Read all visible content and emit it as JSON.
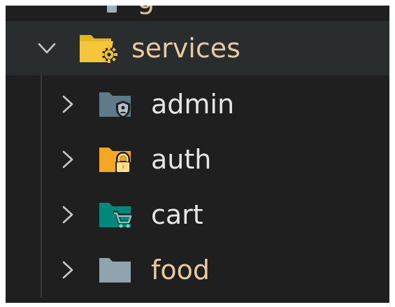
{
  "explorer": {
    "root": {
      "label": "services",
      "icon": "folder-open-gear-icon",
      "expanded": true,
      "color": "#f0c22e"
    },
    "children": [
      {
        "label": "admin",
        "icon": "folder-admin-shield-icon",
        "expanded": false,
        "color": "#607d8b"
      },
      {
        "label": "auth",
        "icon": "folder-auth-lock-icon",
        "expanded": false,
        "color": "#f5a623"
      },
      {
        "label": "cart",
        "icon": "folder-cart-icon",
        "expanded": false,
        "color": "#00897b"
      },
      {
        "label": "food",
        "icon": "folder-icon",
        "expanded": false,
        "color": "#90a4ae"
      }
    ]
  }
}
